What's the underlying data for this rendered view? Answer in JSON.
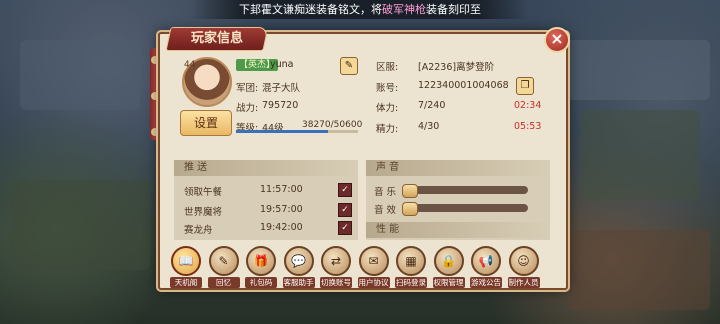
{
  "marquee": {
    "pre": "下邽霍文谦痴迷装备铭文，将",
    "hl": "破军神枪",
    "post": "装备刻印至"
  },
  "panel_title": "玩家信息",
  "close": "×",
  "player": {
    "level": "44",
    "tag": "【英杰】",
    "name": "yuna",
    "legion_label": "军团:",
    "legion": "混子大队",
    "power_label": "战力:",
    "power": "795720",
    "grade_label": "等级:",
    "grade": "44级",
    "exp": "38270/50600",
    "exp_fraction": 0.756,
    "setup_button": "设置",
    "server_label": "区服:",
    "server": "[A2236]离梦登阶",
    "account_label": "账号:",
    "account": "122340001004068",
    "stamina_label": "体力:",
    "stamina": "7/240",
    "stamina_timer": "02:34",
    "energy_label": "精力:",
    "energy": "4/30",
    "energy_timer": "05:53"
  },
  "push": {
    "title": "推 送",
    "rows": [
      {
        "label": "领取午餐",
        "time": "11:57:00",
        "checked": true
      },
      {
        "label": "世界魔将",
        "time": "19:57:00",
        "checked": true
      },
      {
        "label": "赛龙舟",
        "time": "19:42:00",
        "checked": true
      }
    ]
  },
  "sound": {
    "title": "声 音",
    "music_label": "音 乐",
    "effect_label": "音 效",
    "perf_title": "性 能"
  },
  "functions": [
    {
      "icon": "book-icon",
      "label": "天机阁",
      "glyph": "📖",
      "active": true
    },
    {
      "icon": "feather-icon",
      "label": "回忆",
      "glyph": "✎",
      "active": false
    },
    {
      "icon": "gift-icon",
      "label": "礼包码",
      "glyph": "🎁",
      "active": false
    },
    {
      "icon": "chat-icon",
      "label": "客服助手",
      "glyph": "💬",
      "active": false
    },
    {
      "icon": "switch-icon",
      "label": "切换账号",
      "glyph": "⇄",
      "active": false
    },
    {
      "icon": "agreement-icon",
      "label": "用户协议",
      "glyph": "✉",
      "active": false
    },
    {
      "icon": "qr-icon",
      "label": "扫码登录",
      "glyph": "▦",
      "active": false
    },
    {
      "icon": "lock-icon",
      "label": "权限管理",
      "glyph": "🔒",
      "active": false
    },
    {
      "icon": "announce-icon",
      "label": "游戏公告",
      "glyph": "📢",
      "active": false
    },
    {
      "icon": "team-icon",
      "label": "制作人员",
      "glyph": "☺",
      "active": false
    }
  ],
  "colors": {
    "accent": "#a03a34",
    "timer": "#c8322a",
    "panel": "#ece4d1"
  }
}
